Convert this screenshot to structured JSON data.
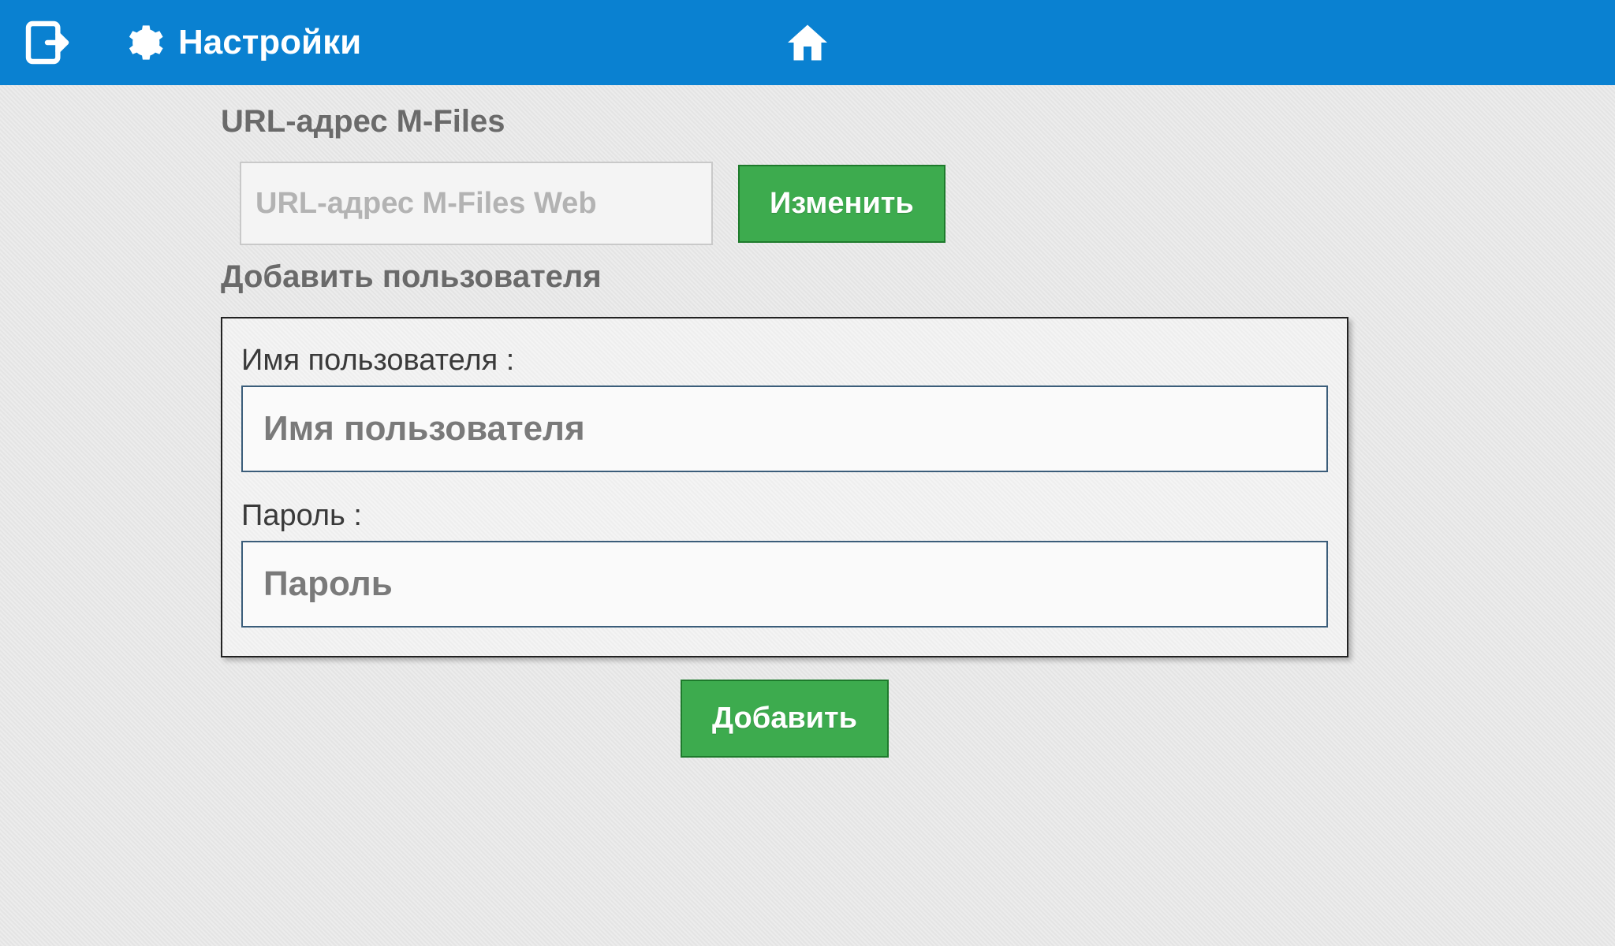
{
  "topbar": {
    "title": "Настройки"
  },
  "url_section": {
    "label": "URL-адрес M-Files",
    "placeholder": "URL-адрес M-Files Web",
    "change_label": "Изменить"
  },
  "add_user_section": {
    "label": "Добавить пользователя",
    "username_label": "Имя пользователя :",
    "username_placeholder": "Имя пользователя",
    "password_label": "Пароль :",
    "password_placeholder": "Пароль",
    "add_label": "Добавить"
  },
  "colors": {
    "topbar_bg": "#0a81d1",
    "button_green": "#3dab4e"
  }
}
